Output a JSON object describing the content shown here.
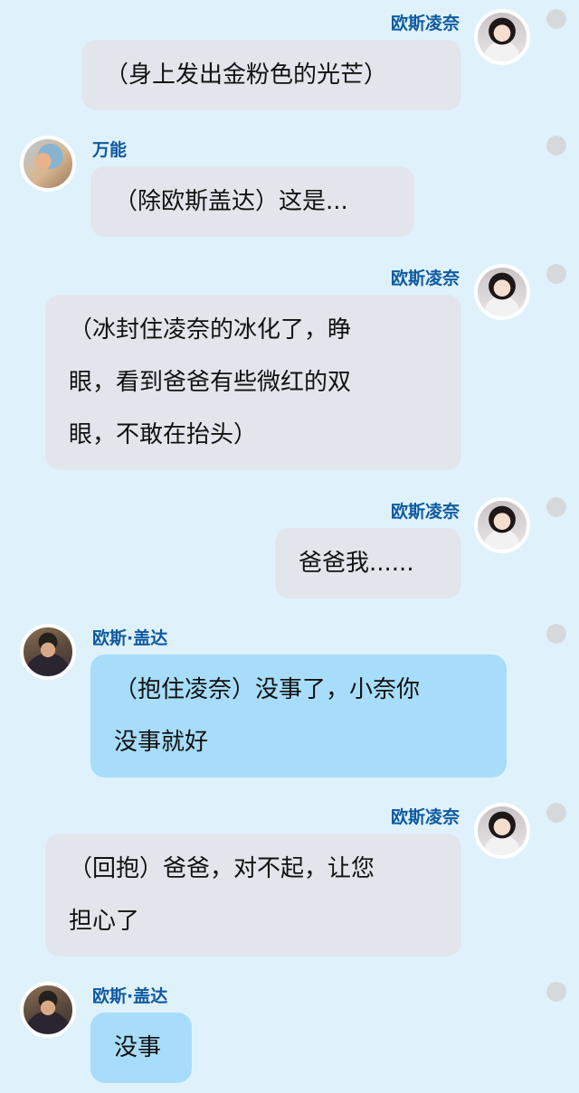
{
  "messages": [
    {
      "side": "right",
      "sender": "欧斯凌奈",
      "avatar": "girl-avatar",
      "lines": [
        "（身上发出金粉色的光芒）"
      ]
    },
    {
      "side": "left",
      "sender": "万能",
      "avatar": "painting-avatar",
      "lines": [
        "（除欧斯盖达）这是..."
      ]
    },
    {
      "side": "right",
      "sender": "欧斯凌奈",
      "avatar": "girl-avatar",
      "lines": [
        "（冰封住凌奈的冰化了，睁",
        "眼，看到爸爸有些微红的双",
        "眼，不敢在抬头）"
      ]
    },
    {
      "side": "right",
      "sender": "欧斯凌奈",
      "avatar": "girl-avatar",
      "lines": [
        "爸爸我......"
      ]
    },
    {
      "side": "left",
      "sender": "欧斯·盖达",
      "avatar": "man-avatar",
      "bubble_color": "#a7ddfa",
      "lines": [
        "（抱住凌奈）没事了，小奈你",
        "没事就好"
      ]
    },
    {
      "side": "right",
      "sender": "欧斯凌奈",
      "avatar": "girl-avatar",
      "lines": [
        "（回抱）爸爸，对不起，让您",
        "担心了"
      ]
    },
    {
      "side": "left",
      "sender": "欧斯·盖达",
      "avatar": "man-avatar",
      "bubble_color": "#a7ddfa",
      "lines": [
        "没事"
      ]
    }
  ]
}
